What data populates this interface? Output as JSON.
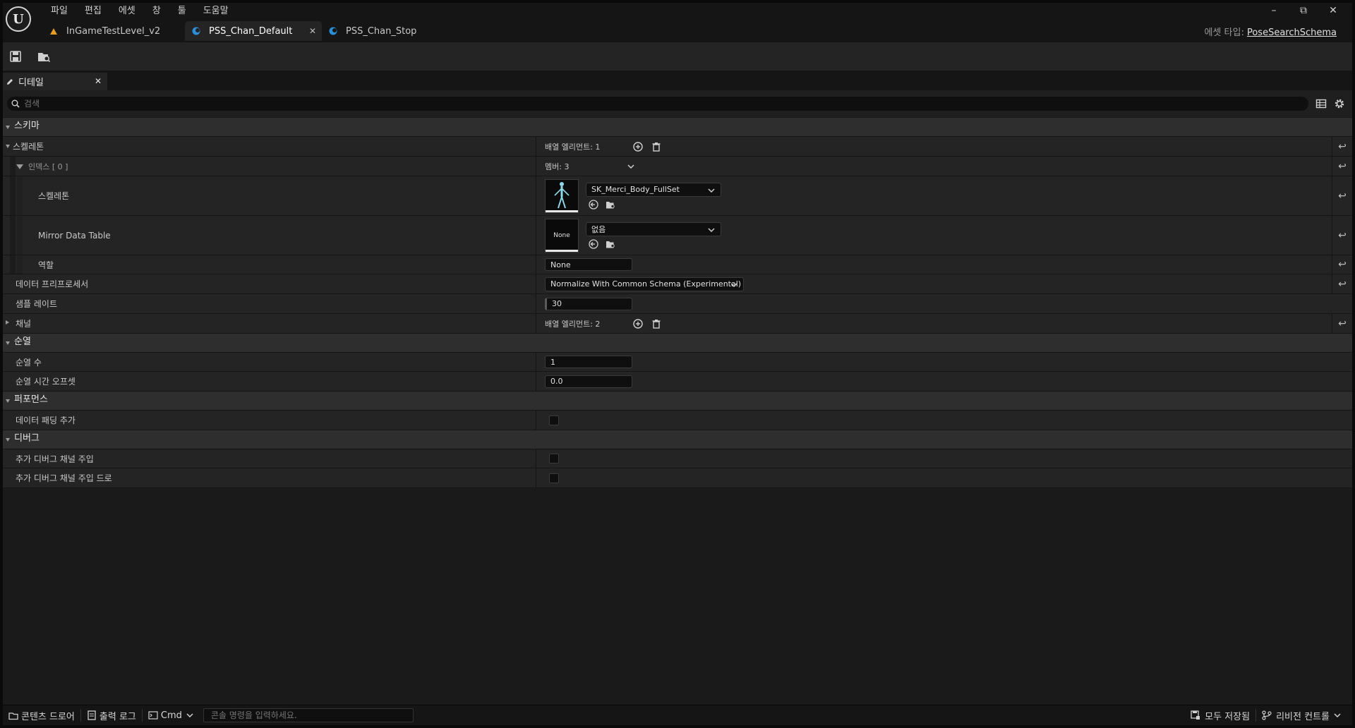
{
  "menu": [
    "파일",
    "편집",
    "에셋",
    "창",
    "툴",
    "도움말"
  ],
  "tabs": [
    {
      "label": "InGameTestLevel_v2",
      "icon": "level-icon"
    },
    {
      "label": "PSS_Chan_Default",
      "icon": "schema-icon",
      "active": true
    },
    {
      "label": "PSS_Chan_Stop",
      "icon": "schema-icon"
    }
  ],
  "asset_type": {
    "label": "에셋 타입:",
    "value": "PoseSearchSchema"
  },
  "panel_tab": {
    "label": "디테일"
  },
  "search": {
    "placeholder": "검색"
  },
  "categories": {
    "schema": "스키마",
    "permutation": "순열",
    "performance": "퍼포먼스",
    "debug": "디버그"
  },
  "props": {
    "skeletons": {
      "name": "스켈레톤",
      "value": "배열 엘리먼트: 1"
    },
    "index0": {
      "name": "인덱스 [ 0 ]",
      "value": "멤버: 3"
    },
    "skeleton": {
      "name": "스켈레톤",
      "asset": "SK_Merci_Body_FullSet"
    },
    "mirror": {
      "name": "Mirror Data Table",
      "asset": "없음",
      "thumb": "None"
    },
    "role": {
      "name": "역할",
      "value": "None"
    },
    "preprocessor": {
      "name": "데이터 프리프로세서",
      "value": "Normalize With Common Schema (Experimental)"
    },
    "sample_rate": {
      "name": "샘플 레이트",
      "value": "30"
    },
    "channels": {
      "name": "채널",
      "value": "배열 엘리먼트: 2"
    },
    "num_perm": {
      "name": "순열 수",
      "value": "1"
    },
    "perm_offset": {
      "name": "순열 시간 오프셋",
      "value": "0.0"
    },
    "padding": {
      "name": "데이터 패딩 추가",
      "checked": false
    },
    "inject_debug": {
      "name": "추가 디버그 채널 주입",
      "checked": false
    },
    "inject_debug_draw": {
      "name": "추가 디버그 채널 주입 드로",
      "checked": false
    }
  },
  "status": {
    "content_drawer": "콘텐츠 드로어",
    "output_log": "출력 로그",
    "cmd": "Cmd",
    "console_placeholder": "콘솔 명령을 입력하세요.",
    "save_all": "모두 저장됨",
    "revision_control": "리비전 컨트롤"
  }
}
